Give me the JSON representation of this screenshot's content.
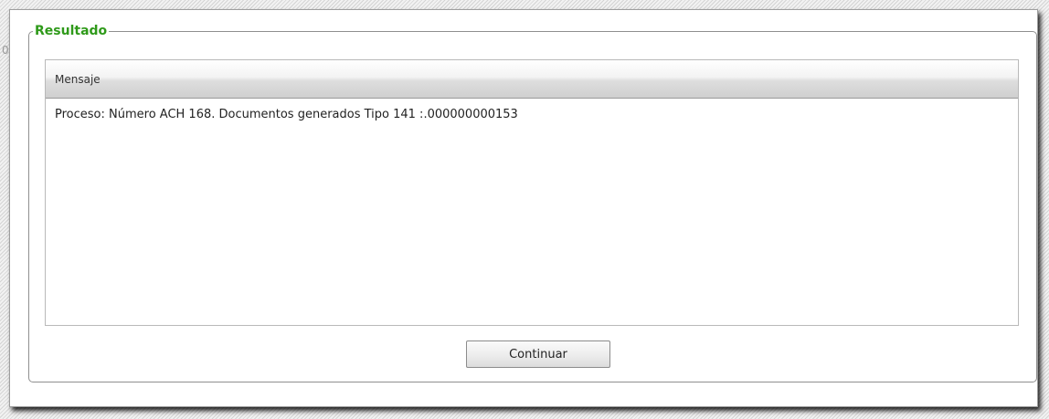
{
  "backdrop": {
    "fragment": "0"
  },
  "dialog": {
    "legend": "Resultado",
    "grid": {
      "column_header": "Mensaje",
      "rows": [
        "Proceso: Número ACH 168. Documentos generados Tipo 141 :.000000000153"
      ]
    },
    "continue_label": "Continuar"
  }
}
